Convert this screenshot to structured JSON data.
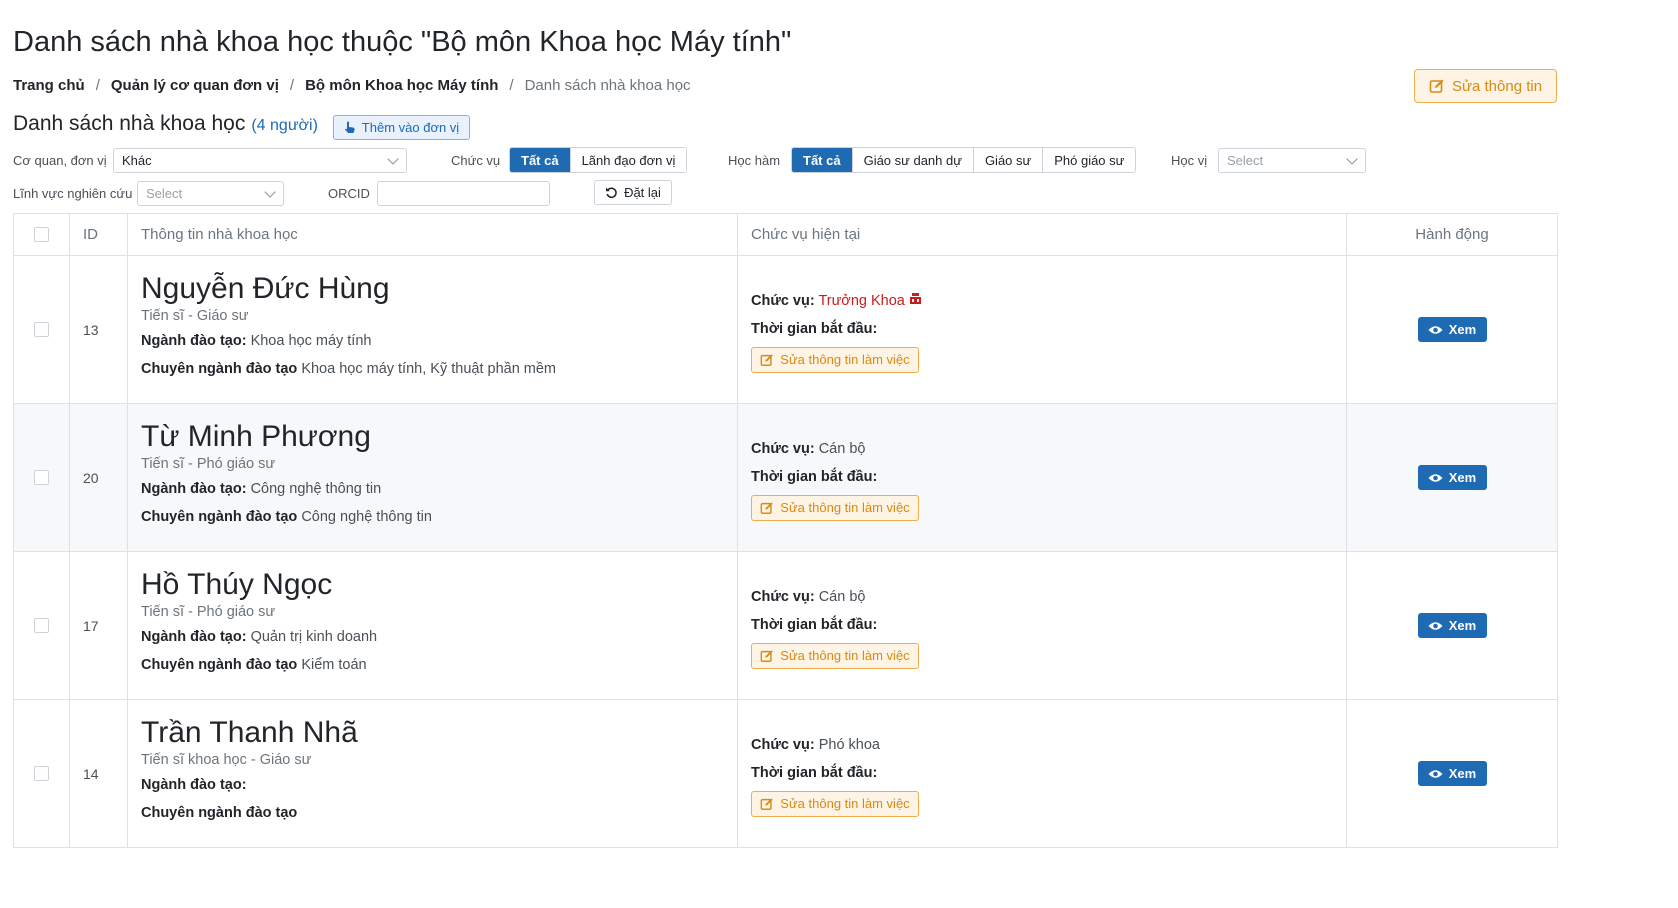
{
  "page": {
    "title": "Danh sách nhà khoa học thuộc \"Bộ môn Khoa học Máy tính\"",
    "breadcrumb": [
      "Trang chủ",
      "Quản lý cơ quan đơn vị",
      "Bộ môn Khoa học Máy tính",
      "Danh sách nhà khoa học"
    ],
    "edit_info_label": "Sửa thông tin"
  },
  "section": {
    "title": "Danh sách nhà khoa học",
    "count": "(4 người)",
    "add_label": "Thêm vào đơn vị"
  },
  "filters": {
    "org_label": "Cơ quan, đơn vị",
    "org_value": "Khác",
    "position_label": "Chức vụ",
    "position_options": [
      "Tất cả",
      "Lãnh đạo đơn vị"
    ],
    "position_selected": "Tất cả",
    "title_label": "Học hàm",
    "title_options": [
      "Tất cả",
      "Giáo sư danh dự",
      "Giáo sư",
      "Phó giáo sư"
    ],
    "title_selected": "Tất cả",
    "degree_label": "Học vị",
    "degree_placeholder": "Select",
    "field_label": "Lĩnh vực nghiên cứu",
    "field_placeholder": "Select",
    "orcid_label": "ORCID",
    "orcid_value": "",
    "reset_label": "Đặt lại"
  },
  "table": {
    "headers": [
      "ID",
      "Thông tin nhà khoa học",
      "Chức vụ hiện tại",
      "Hành động"
    ],
    "label_major": "Ngành đào tạo:",
    "label_specialty": "Chuyên ngành đào tạo",
    "label_position": "Chức vụ:",
    "label_start": "Thời gian bắt đầu:",
    "edit_work_label": "Sửa thông tin làm việc",
    "view_label": "Xem",
    "rows": [
      {
        "id": "13",
        "name": "Nguyễn Đức Hùng",
        "degree": "Tiến sĩ - Giáo sư",
        "major": "Khoa học máy tính",
        "specialty": "Khoa học máy tính, Kỹ thuật phần mềm",
        "position": "Trưởng Khoa",
        "highlight": true
      },
      {
        "id": "20",
        "name": "Từ Minh Phương",
        "degree": "Tiến sĩ - Phó giáo sư",
        "major": "Công nghệ thông tin",
        "specialty": "Công nghệ thông tin",
        "position": "Cán bộ",
        "highlight": false
      },
      {
        "id": "17",
        "name": "Hồ Thúy Ngọc",
        "degree": "Tiến sĩ - Phó giáo sư",
        "major": "Quản trị kinh doanh",
        "specialty": "Kiểm toán",
        "position": "Cán bộ",
        "highlight": false
      },
      {
        "id": "14",
        "name": "Trần Thanh Nhã",
        "degree": "Tiến sĩ khoa học - Giáo sư",
        "major": "",
        "specialty": "",
        "position": "Phó khoa",
        "highlight": false
      }
    ]
  },
  "colors": {
    "primary": "#1e6ab3",
    "warning": "#f0ad4e",
    "danger": "#c81d1d"
  }
}
